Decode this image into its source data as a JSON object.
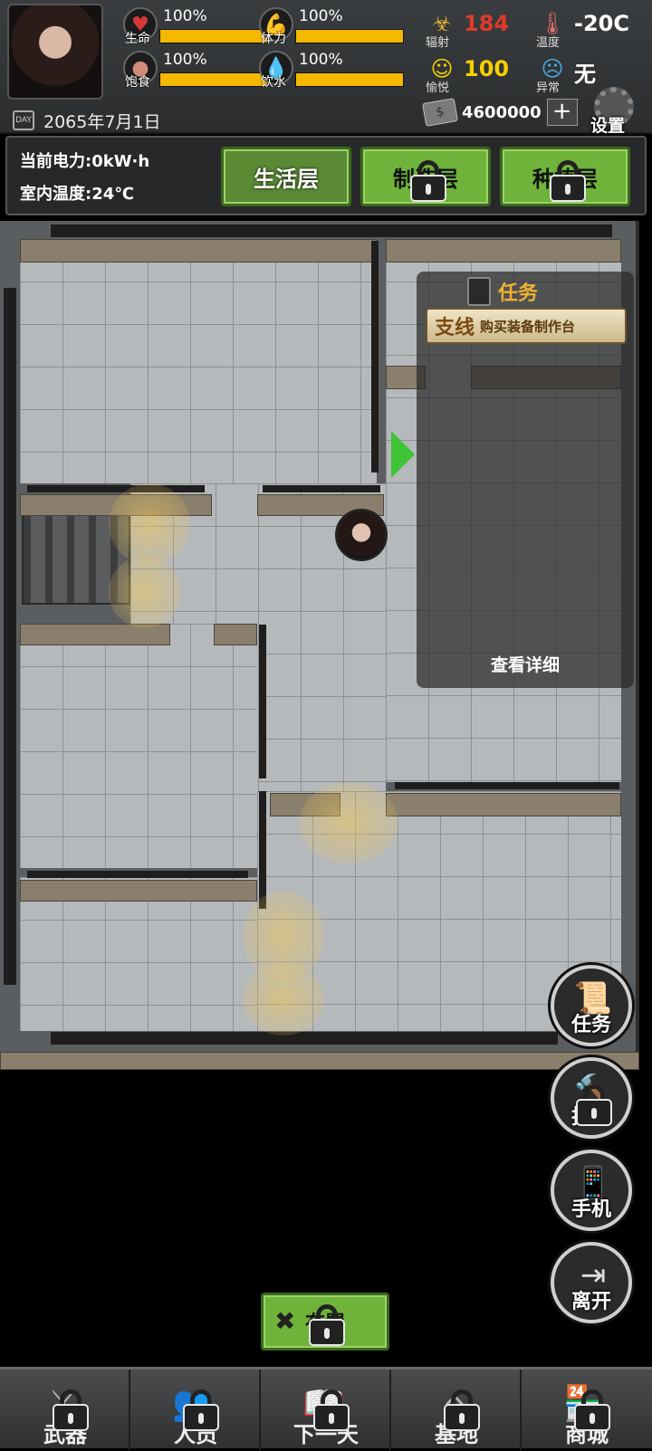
{
  "hud": {
    "stats": [
      {
        "name": "生命",
        "value": "100%",
        "icon": "heart-icon",
        "level": 1.0
      },
      {
        "name": "体力",
        "value": "100%",
        "icon": "muscle-icon",
        "level": 1.0
      },
      {
        "name": "饱食",
        "value": "100%",
        "icon": "stomach-icon",
        "level": 1.0
      },
      {
        "name": "饮水",
        "value": "100%",
        "icon": "water-drop-icon",
        "level": 1.0
      }
    ],
    "radiation": {
      "label": "辐射",
      "value": "184",
      "icon": "biohazard-icon",
      "color": "#e03a2a"
    },
    "temperature": {
      "label": "温度",
      "value": "-20C",
      "icon": "thermometer-icon",
      "color": "#ffffff"
    },
    "mood": {
      "label": "愉悦",
      "value": "100",
      "icon": "smile-icon",
      "color": "#f5d000"
    },
    "abnormal": {
      "label": "异常",
      "value": "无",
      "icon": "sad-face-icon",
      "color": "#ffffff"
    },
    "date": "2065年7月1日",
    "money": "4600000",
    "money_plus": "+",
    "settings_label": "设置"
  },
  "info": {
    "power": "当前电力:0kW·h",
    "indoor_temp": "室内温度:24℃"
  },
  "floors": [
    {
      "label": "生活层",
      "locked": false,
      "active": true
    },
    {
      "label": "制造层",
      "locked": true,
      "active": false
    },
    {
      "label": "种植层",
      "locked": true,
      "active": false
    }
  ],
  "task_panel": {
    "title": "任务",
    "type": "支线",
    "name": "购买装备制作台",
    "detail": "查看详细"
  },
  "side_buttons": [
    {
      "label": "任务",
      "icon": "scroll-icon",
      "locked": false
    },
    {
      "label": "拍卖",
      "icon": "gavel-icon",
      "locked": true
    },
    {
      "label": "手机",
      "icon": "phone-icon",
      "locked": false
    },
    {
      "label": "离开",
      "icon": "exit-door-icon",
      "locked": false
    }
  ],
  "build_button": {
    "label": "布置",
    "icon": "tools-icon",
    "locked": true
  },
  "bottom_nav": [
    {
      "label": "武器",
      "icon": "crossed-swords-icon",
      "locked": true
    },
    {
      "label": "人员",
      "icon": "people-icon",
      "locked": true
    },
    {
      "label": "下一天",
      "icon": "book-icon",
      "locked": true
    },
    {
      "label": "基地",
      "icon": "house-icon",
      "locked": true
    },
    {
      "label": "商城",
      "icon": "shop-icon",
      "locked": true
    }
  ],
  "colors": {
    "accent_green": "#6fb33a",
    "stat_bar": "#f5b800",
    "task_title": "#f0b030"
  }
}
